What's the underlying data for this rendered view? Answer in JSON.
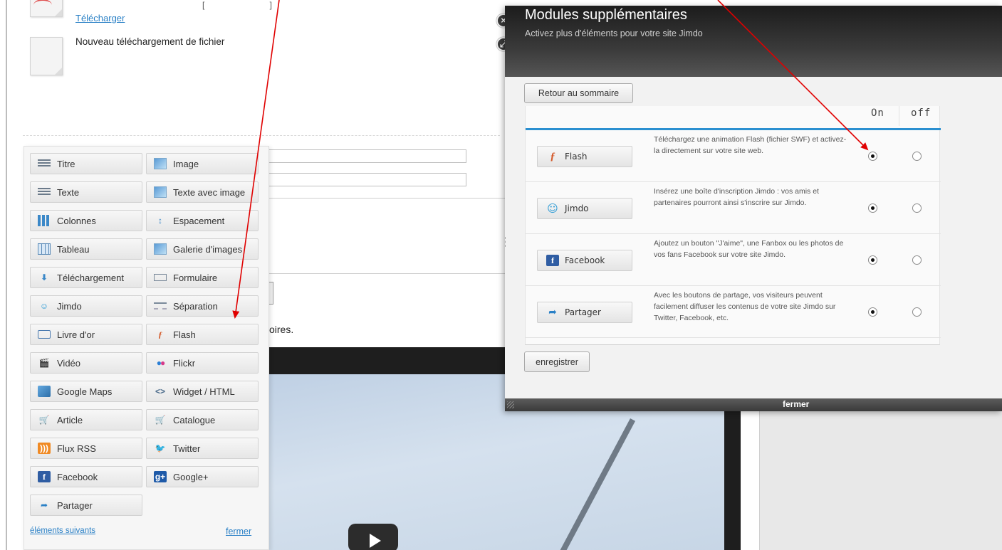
{
  "background_page": {
    "download_link": "Télécharger",
    "download_title": "Nouveau téléchargement de fichier",
    "bracket_text": "[ ]",
    "text_tail": "oires."
  },
  "elements_menu": {
    "items": [
      {
        "label": "Titre",
        "icon": "title-icon"
      },
      {
        "label": "Image",
        "icon": "image-icon"
      },
      {
        "label": "Texte",
        "icon": "text-icon"
      },
      {
        "label": "Texte avec image",
        "icon": "text-image-icon"
      },
      {
        "label": "Colonnes",
        "icon": "columns-icon"
      },
      {
        "label": "Espacement",
        "icon": "spacing-icon"
      },
      {
        "label": "Tableau",
        "icon": "table-icon"
      },
      {
        "label": "Galerie d'images",
        "icon": "gallery-icon"
      },
      {
        "label": "Téléchargement",
        "icon": "download-icon"
      },
      {
        "label": "Formulaire",
        "icon": "form-icon"
      },
      {
        "label": "Jimdo",
        "icon": "jimdo-icon"
      },
      {
        "label": "Séparation",
        "icon": "separator-icon"
      },
      {
        "label": "Livre d'or",
        "icon": "guestbook-icon"
      },
      {
        "label": "Flash",
        "icon": "flash-icon"
      },
      {
        "label": "Vidéo",
        "icon": "video-icon"
      },
      {
        "label": "Flickr",
        "icon": "flickr-icon"
      },
      {
        "label": "Google Maps",
        "icon": "google-maps-icon"
      },
      {
        "label": "Widget / HTML",
        "icon": "widget-html-icon"
      },
      {
        "label": "Article",
        "icon": "cart-icon"
      },
      {
        "label": "Catalogue",
        "icon": "catalogue-icon"
      },
      {
        "label": "Flux RSS",
        "icon": "rss-icon"
      },
      {
        "label": "Twitter",
        "icon": "twitter-icon"
      },
      {
        "label": "Facebook",
        "icon": "facebook-icon"
      },
      {
        "label": "Google+",
        "icon": "google-plus-icon"
      },
      {
        "label": "Partager",
        "icon": "share-icon"
      }
    ],
    "next_link": "éléments suivants",
    "close_link": "fermer"
  },
  "modal": {
    "title": "Modules supplémentaires",
    "subtitle": "Activez plus d'éléments pour votre site Jimdo",
    "back_button": "Retour au sommaire",
    "col_on": "On",
    "col_off": "off",
    "modules": [
      {
        "name": "Flash",
        "icon": "flash-icon",
        "description": "Téléchargez une animation Flash (fichier SWF) et activez-la directement sur votre site web.",
        "state": "on"
      },
      {
        "name": "Jimdo",
        "icon": "jimdo-icon",
        "description": "Insérez une boîte d'inscription Jimdo : vos amis et partenaires pourront ainsi s'inscrire sur Jimdo.",
        "state": "on"
      },
      {
        "name": "Facebook",
        "icon": "facebook-icon",
        "description": "Ajoutez un bouton \"J'aime\", une Fanbox ou les photos de vos fans Facebook sur votre site Jimdo.",
        "state": "on"
      },
      {
        "name": "Partager",
        "icon": "share-icon",
        "description": "Avec les boutons de partage, vos visiteurs peuvent facilement diffuser les contenus de votre site Jimdo sur Twitter, Facebook, etc.",
        "state": "on"
      }
    ],
    "save_button": "enregistrer",
    "footer_close": "fermer",
    "close_glyph": "×",
    "expand_glyph": "⤢"
  },
  "colors": {
    "link": "#2a80c6",
    "accent_rule": "#2a8fd0",
    "arrow": "#e00000",
    "modal_header": "#2a2a2a"
  }
}
